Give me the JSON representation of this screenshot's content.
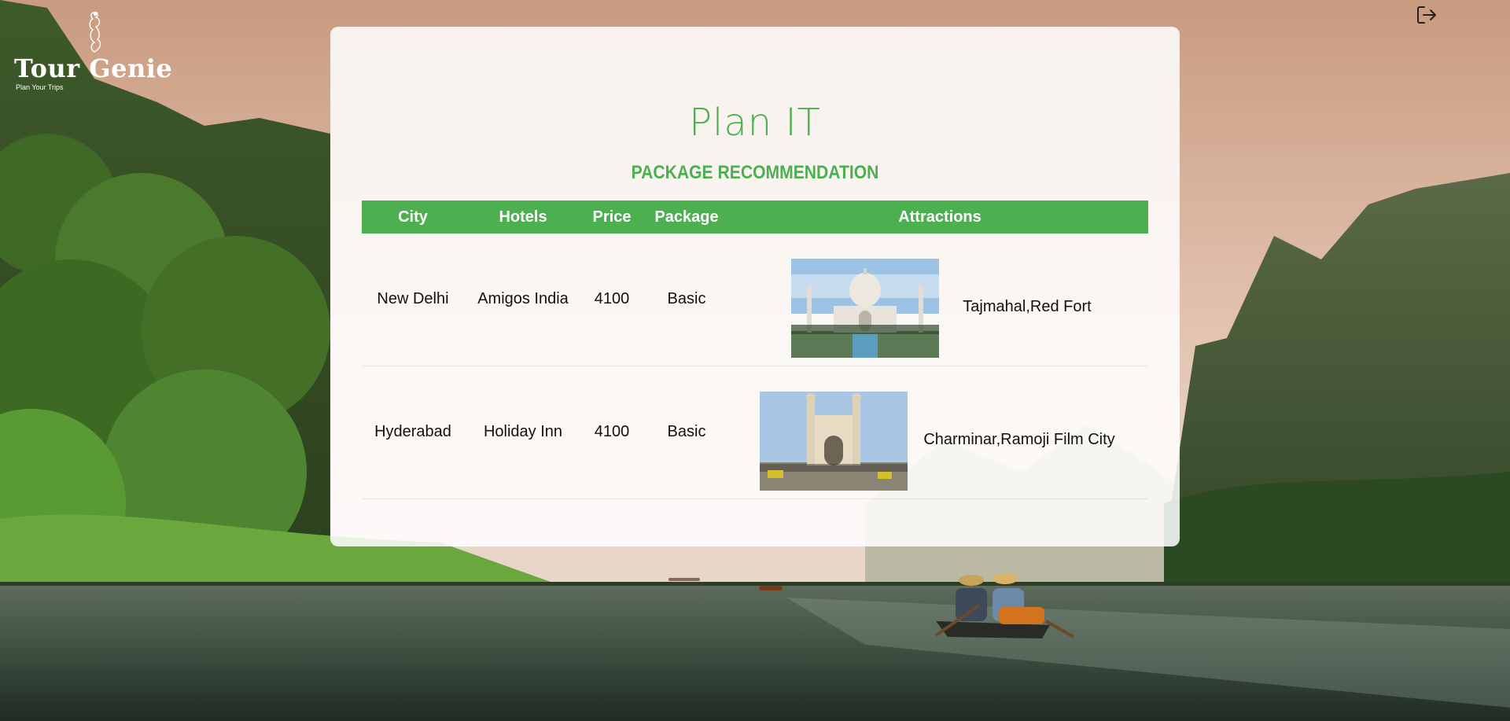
{
  "brand": {
    "name": "Tour Genie",
    "tagline": "Plan Your Trips"
  },
  "header": {
    "logout_icon": "logout-icon"
  },
  "panel": {
    "title": "Plan IT",
    "section_title": "PACKAGE RECOMMENDATION"
  },
  "table": {
    "columns": [
      "City",
      "Hotels",
      "Price",
      "Package",
      "Attractions"
    ],
    "rows": [
      {
        "city": "New Delhi",
        "hotel": "Amigos India",
        "price": "4100",
        "package": "Basic",
        "image": "taj-mahal-photo",
        "attractions": "Tajmahal,Red Fort"
      },
      {
        "city": "Hyderabad",
        "hotel": "Holiday Inn",
        "price": "4100",
        "package": "Basic",
        "image": "charminar-photo",
        "attractions": "Charminar,Ramoji Film City"
      }
    ]
  },
  "colors": {
    "accent": "#4caf50",
    "panel_bg": "rgba(255,255,255,0.86)",
    "header_text": "#ffffff"
  }
}
